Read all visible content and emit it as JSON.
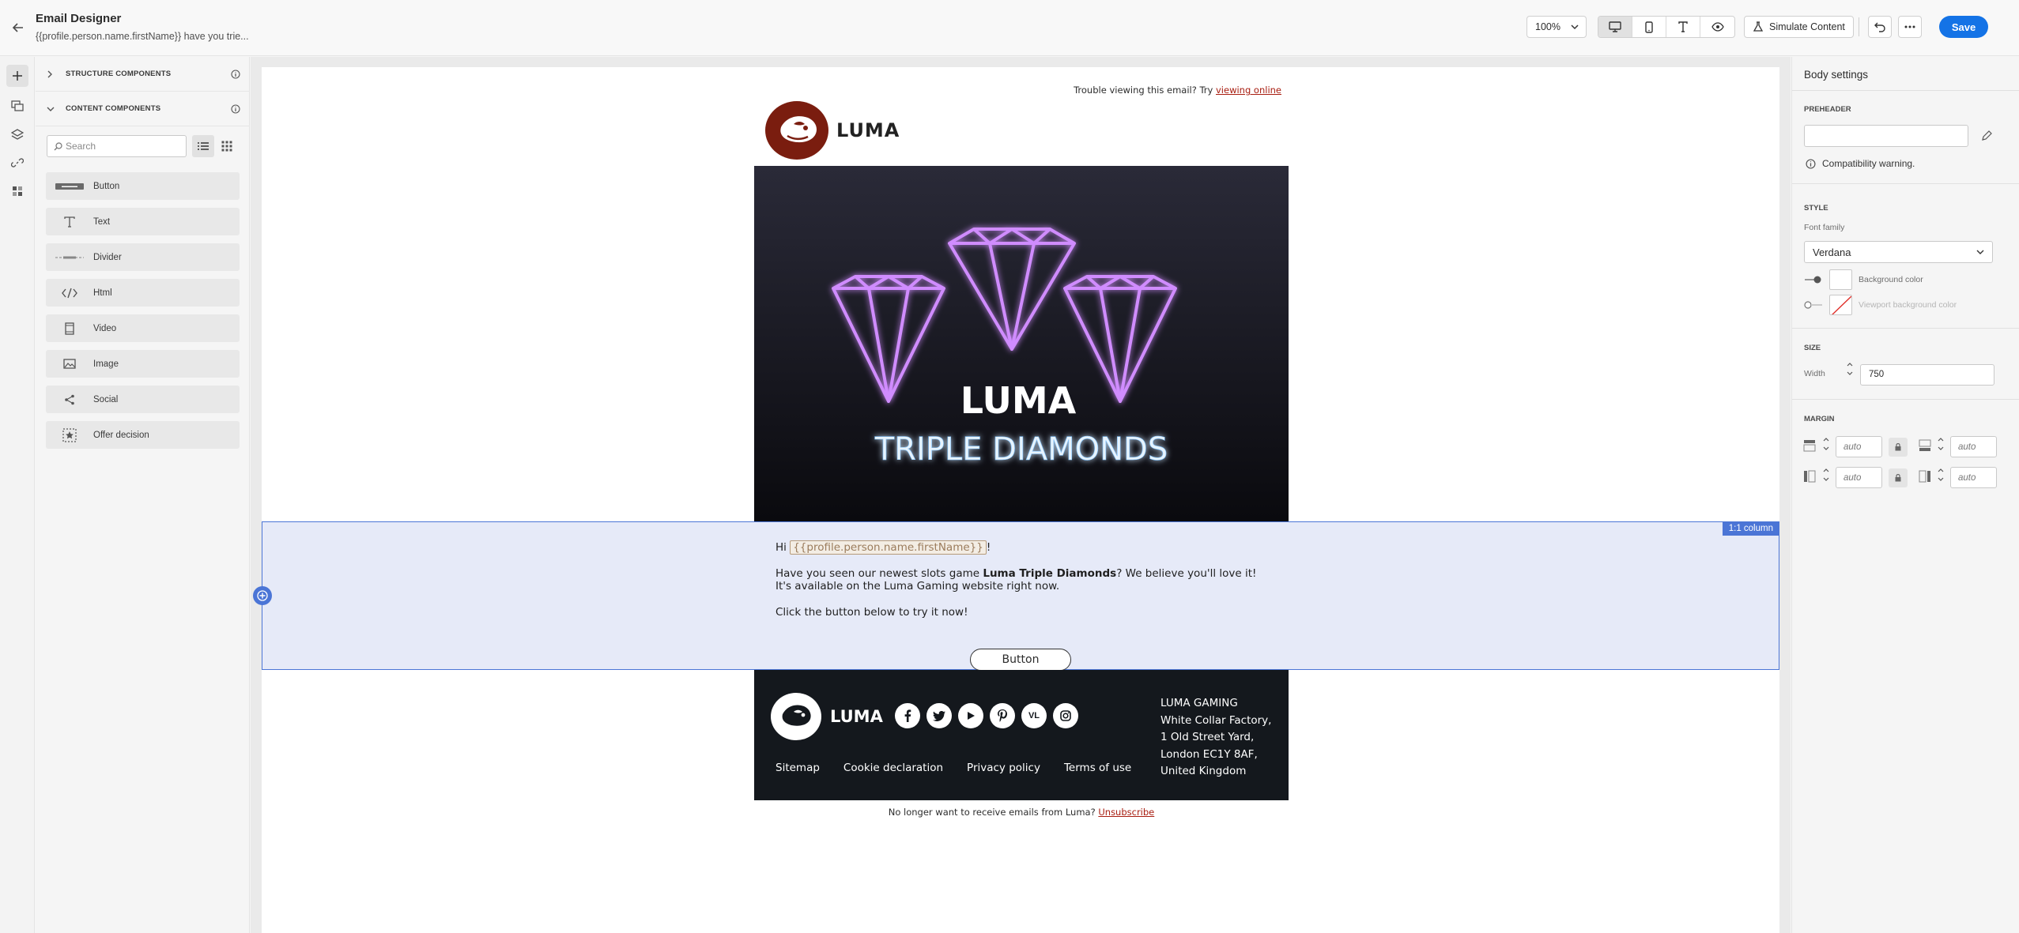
{
  "header": {
    "app_title": "Email Designer",
    "subject": "{{profile.person.name.firstName}} have you trie...",
    "zoom": "100%",
    "simulate_label": "Simulate Content",
    "save_label": "Save"
  },
  "rail": {
    "icons": [
      "plus-icon",
      "templates-icon",
      "layers-icon",
      "link-icon",
      "fragments-icon"
    ]
  },
  "components": {
    "structure_title": "STRUCTURE COMPONENTS",
    "content_title": "CONTENT COMPONENTS",
    "search_placeholder": "Search",
    "items": [
      {
        "label": "Button",
        "icon": "button-icon"
      },
      {
        "label": "Text",
        "icon": "text-icon"
      },
      {
        "label": "Divider",
        "icon": "divider-icon"
      },
      {
        "label": "Html",
        "icon": "code-icon"
      },
      {
        "label": "Video",
        "icon": "video-icon"
      },
      {
        "label": "Image",
        "icon": "image-icon"
      },
      {
        "label": "Social",
        "icon": "share-icon"
      },
      {
        "label": "Offer decision",
        "icon": "offer-icon"
      }
    ]
  },
  "email": {
    "trouble_text": "Trouble viewing this email? Try ",
    "trouble_link": "viewing online",
    "logo_text": "LUMA",
    "hero_title": "LUMA",
    "hero_subtitle": "TRIPLE DIAMONDS",
    "column_badge": "1:1 column",
    "greeting_hi": "Hi ",
    "greeting_token": "{{profile.person.name.firstName}}",
    "greeting_end": "!",
    "para1_start": "Have you seen our newest slots game ",
    "para1_bold": "Luma Triple Diamonds",
    "para1_end": "? We believe you'll love it! It's available on the Luma Gaming website right now.",
    "para2": "Click the button below to try it now!",
    "button_label": "Button",
    "footer": {
      "logo_text": "LUMA",
      "socials": [
        "facebook-icon",
        "twitter-icon",
        "youtube-icon",
        "pinterest-icon",
        "vl-icon",
        "instagram-icon"
      ],
      "social_vl_text": "VL",
      "links": [
        "Sitemap",
        "Cookie declaration",
        "Privacy policy",
        "Terms of use"
      ],
      "address": [
        "LUMA GAMING",
        "White Collar Factory,",
        "1 Old Street Yard,",
        "London EC1Y 8AF,",
        "United Kingdom"
      ]
    },
    "unsub_text": "No longer want to receive emails from Luma? ",
    "unsub_link": "Unsubscribe"
  },
  "props": {
    "title": "Body settings",
    "preheader_label": "PREHEADER",
    "preheader_value": "",
    "compat_warning": "Compatibility warning.",
    "style_label": "STYLE",
    "font_family_label": "Font family",
    "font_family_value": "Verdana",
    "bg_color_label": "Background color",
    "viewport_bg_label": "Viewport background color",
    "size_label": "SIZE",
    "width_label": "Width",
    "width_value": "750",
    "margin_label": "MARGIN",
    "margin_placeholder": "auto"
  },
  "colors": {
    "accent": "#1473e6",
    "selection": "#4b75d6",
    "footer_bg": "#14181d",
    "hero_purple": "#c86bff",
    "link_red": "#a81d10"
  }
}
